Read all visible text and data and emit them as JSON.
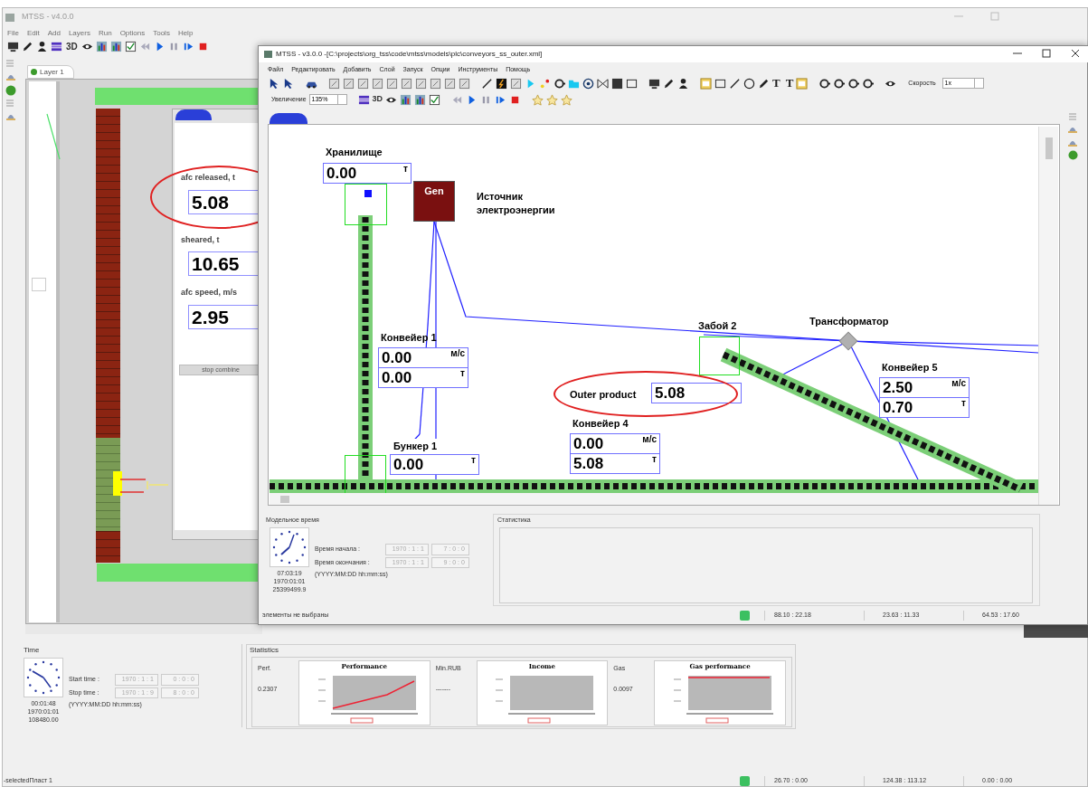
{
  "back_window": {
    "title": "MTSS - v4.0.0",
    "menu": [
      "File",
      "Edit",
      "Add",
      "Layers",
      "Run",
      "Options",
      "Tools",
      "Help"
    ],
    "toolbar_3d": "3D",
    "layer_tab": "Layer 1",
    "dialog": {
      "fields": [
        {
          "label": "afc released, t",
          "value": "5.08",
          "highlighted": true
        },
        {
          "label": "sheared, t",
          "value": "10.65",
          "highlighted": false
        },
        {
          "label": "afc speed, m/s",
          "value": "2.95",
          "highlighted": false
        }
      ],
      "button": "stop combine"
    },
    "time_panel": {
      "title": "Time",
      "start_label": "Start time :",
      "stop_label": "Stop time :",
      "format": "(YYYY:MM:DD hh:mm:ss)",
      "start_date": "1970 : 1 : 1",
      "start_time": "0 : 0 : 0",
      "stop_date": "1970 : 1 : 9",
      "stop_time": "8 : 0 : 0",
      "clock_time": "00:01:48",
      "clock_date": "1970:01:01",
      "clock_seconds": "108480.00"
    },
    "statistics": {
      "title": "Statistics",
      "items": [
        {
          "label": "Perf.",
          "value": "0.2307",
          "chart_title": "Performance",
          "kind": "rising"
        },
        {
          "label": "Min.RUB",
          "value": "-------",
          "chart_title": "Income",
          "kind": "empty"
        },
        {
          "label": "Gas",
          "value": "0.0097",
          "chart_title": "Gas performance",
          "kind": "flat"
        }
      ]
    },
    "status_bar": [
      "-selectedПласт 1",
      "26.70 : 0.00",
      "124.38 : 113.12",
      "0.00 : 0.00"
    ]
  },
  "front_window": {
    "title": "MTSS - v3.0.0 -[C:\\projects\\org_tss\\code\\mtss\\models\\plc\\conveyors_ss_outer.xml]",
    "menu": [
      "Файл",
      "Редактировать",
      "Добавить",
      "Слой",
      "Запуск",
      "Опции",
      "Инструменты",
      "Помощь"
    ],
    "toolbar": {
      "text_tools": [
        "T",
        "T"
      ],
      "speed_label": "Скорость",
      "speed": "1x",
      "zoom_label": "Увеличение",
      "zoom": "135%",
      "mode_3d": "3D"
    },
    "canvas": {
      "storage": {
        "title": "Хранилище",
        "value": "0.00",
        "unit": "т"
      },
      "generator": {
        "label": "Gen",
        "caption_lines": [
          "Источник",
          "электроэнергии"
        ]
      },
      "conveyors": [
        {
          "title": "Конвейер 1",
          "speed": "0.00",
          "speed_unit": "м/с",
          "load": "0.00",
          "load_unit": "т"
        },
        {
          "title": "Конвейер 4",
          "speed": "0.00",
          "speed_unit": "м/с",
          "load": "5.08",
          "load_unit": "т"
        },
        {
          "title": "Конвейер 5",
          "speed": "2.50",
          "speed_unit": "м/с",
          "load": "0.70",
          "load_unit": "т"
        }
      ],
      "bunker": {
        "title": "Бункер 1",
        "value": "0.00",
        "unit": "т"
      },
      "outer_product": {
        "label": "Outer product",
        "value": "5.08",
        "highlighted": true
      },
      "face": {
        "title": "Забой 2"
      },
      "transformer": {
        "title": "Трансформатор"
      }
    },
    "time_panel": {
      "title": "Модельное время",
      "start_label": "Время начала :",
      "stop_label": "Время окончания :",
      "format": "(YYYY:MM:DD hh:mm:ss)",
      "start_date": "1970 : 1 : 1",
      "start_time": "7 : 0 : 0",
      "stop_date": "1970 : 1 : 1",
      "stop_time": "9 : 0 : 0",
      "clock_time": "07:03:19",
      "clock_date": "1970:01:01",
      "clock_seconds": "25399499.9"
    },
    "statistics": {
      "title": "Статистика"
    },
    "status_bar": [
      "элементы не выбраны",
      "88.10 : 22.18",
      "23.63 : 11.33",
      "64.53 : 17.60"
    ]
  }
}
